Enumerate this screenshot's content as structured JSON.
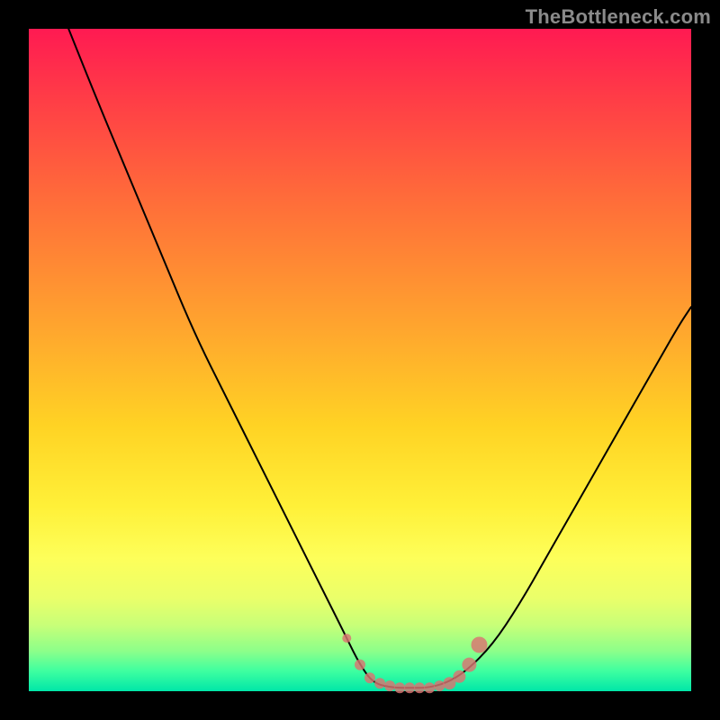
{
  "watermark": "TheBottleneck.com",
  "colors": {
    "frame": "#000000",
    "curve": "#000000",
    "marker_fill": "#db7472",
    "marker_stroke": "#db7472",
    "gradient_top": "#ff1a52",
    "gradient_mid": "#fff038",
    "gradient_bottom": "#00e6a8"
  },
  "chart_data": {
    "type": "line",
    "title": "",
    "xlabel": "",
    "ylabel": "",
    "xlim": [
      0,
      100
    ],
    "ylim": [
      0,
      100
    ],
    "grid": false,
    "legend": false,
    "series": [
      {
        "name": "bottleneck-curve",
        "x": [
          6,
          10,
          15,
          20,
          25,
          30,
          35,
          40,
          45,
          48,
          50,
          52,
          55,
          58,
          60,
          63,
          66,
          70,
          74,
          78,
          82,
          86,
          90,
          94,
          98,
          100
        ],
        "y": [
          100,
          90,
          78,
          66,
          54,
          44,
          34,
          24,
          14,
          8,
          4,
          1.2,
          0.5,
          0.5,
          0.5,
          1.2,
          3,
          7,
          13,
          20,
          27,
          34,
          41,
          48,
          55,
          58
        ]
      }
    ],
    "markers": {
      "name": "highlight-beads",
      "x": [
        48,
        50,
        51.5,
        53,
        54.5,
        56,
        57.5,
        59,
        60.5,
        62,
        63.5,
        65,
        66.5,
        68
      ],
      "y": [
        8,
        4,
        2,
        1.2,
        0.8,
        0.5,
        0.5,
        0.5,
        0.5,
        0.8,
        1.2,
        2.2,
        4,
        7
      ],
      "r": [
        5,
        6,
        6,
        6,
        6,
        6,
        6,
        6,
        6,
        6,
        7,
        7,
        8,
        9
      ]
    },
    "annotations": []
  }
}
